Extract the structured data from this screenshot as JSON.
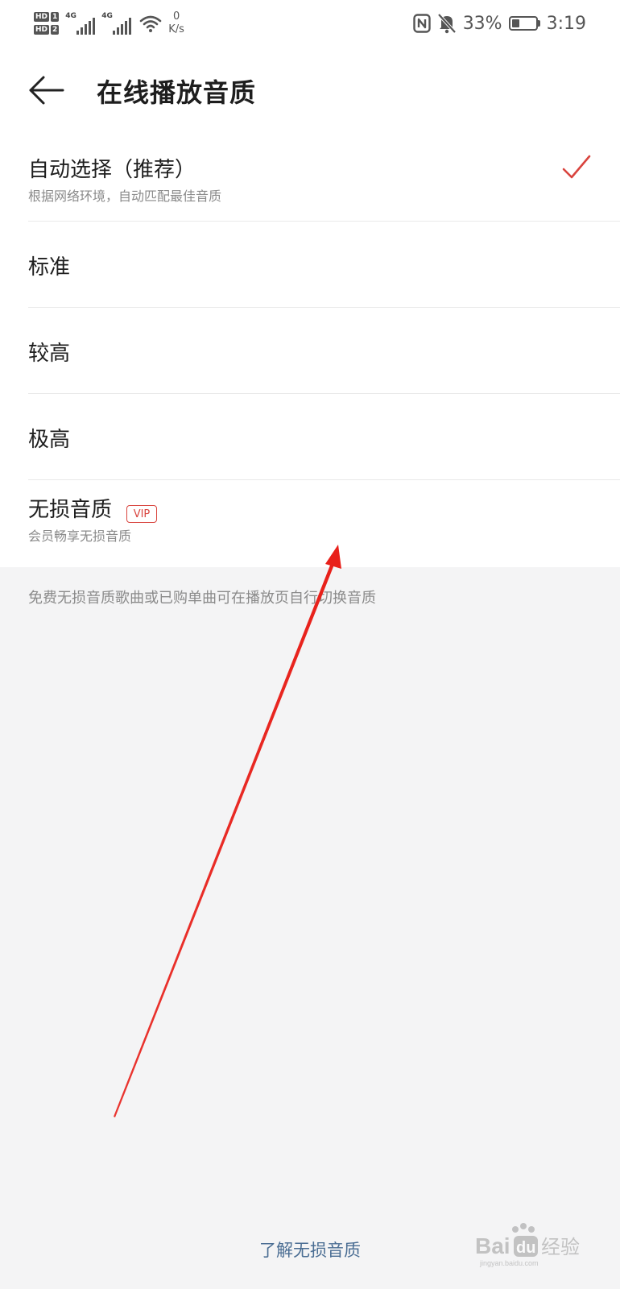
{
  "status_bar": {
    "hd_badges": [
      {
        "tag": "HD",
        "slot": "1"
      },
      {
        "tag": "HD",
        "slot": "2"
      }
    ],
    "signals": [
      {
        "tag": "4G"
      },
      {
        "tag": "4G"
      }
    ],
    "net_speed_value": "0",
    "net_speed_unit": "K/s",
    "battery_percent": "33%",
    "battery_level": 0.33,
    "time": "3:19",
    "icons": [
      "nfc-icon",
      "bell-off-icon",
      "wifi-icon",
      "battery-icon"
    ]
  },
  "header": {
    "title": "在线播放音质"
  },
  "options": [
    {
      "label": "自动选择（推荐）",
      "subtitle": "根据网络环境，自动匹配最佳音质",
      "selected": true
    },
    {
      "label": "标准"
    },
    {
      "label": "较高"
    },
    {
      "label": "极高"
    },
    {
      "label": "无损音质",
      "subtitle": "会员畅享无损音质",
      "badge": "VIP"
    }
  ],
  "note": "免费无损音质歌曲或已购单曲可在播放页自行切换音质",
  "learn_more": "了解无损音质",
  "colors": {
    "accent": "#d9443e",
    "link": "#4a6d93",
    "background": "#f4f4f5",
    "annotation": "#e8201a"
  }
}
